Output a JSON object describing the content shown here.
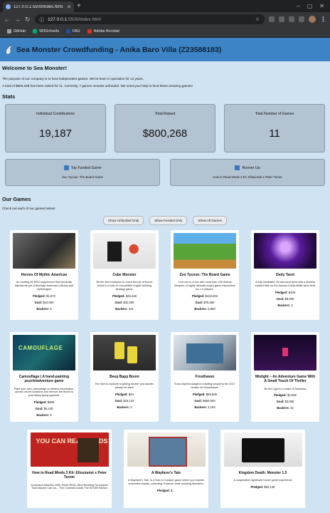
{
  "browser": {
    "tab_title": "127.0.0.1:5500/index.html",
    "url_host": "127.0.0.1",
    "url_path": ":5500/index.html",
    "bookmarks": [
      "GitHub",
      "W3Schools",
      "FAU",
      "Adobe Acrobat"
    ]
  },
  "header": {
    "title": "Sea Monster Crowdfunding - Anika Baro Villa (Z23588183)"
  },
  "intro": {
    "welcome": "Welcome to Sea Monster!",
    "line1": "The purpose of our company is to fund independent games. We've been in operation for 12 years.",
    "line2": "A total of $800,268 has been raised for 11. Currently, 7 games remains unfunded. We need your help to fund these amazing games!"
  },
  "stats": {
    "heading": "Stats",
    "contributions_label": "Individual Contributions",
    "contributions_value": "19,187",
    "raised_label": "Total Raised",
    "raised_value": "$800,268",
    "games_label": "Total Number of Games",
    "games_value": "11",
    "top_label": "Top Funded Game",
    "top_name": "Zoo Tycoon: The Board Game",
    "runner_label": "Runner Up",
    "runner_name": "How to Read Minds 2 Kit: Ellusionist x Peter Turner"
  },
  "games_section": {
    "heading": "Our Games",
    "subtitle": "Check out each of our games below!",
    "btn_unfunded": "Show Unfunded Only",
    "btn_funded": "Show Funded Only",
    "btn_all": "Show All Games"
  },
  "games": [
    {
      "name": "Heroes Of Mythic Americas",
      "desc": "An exciting 5e RPG supplement that heroically represents pre-Columbian American cultures and mythologies",
      "pledged": "Pledged: $1,572",
      "goal": "Goal: $10,000",
      "backers": "Backers: 9"
    },
    {
      "name": "Cube Monster",
      "desc": "Be the first champion to reach the top of Mount Kubia in a solo or competitive engine building strategy game.",
      "pledged": "Pledged: $29,446",
      "goal": "Goal: $32,000",
      "backers": "Backers: 321"
    },
    {
      "name": "Zoo Tycoon: The Board Game",
      "desc": "Your zoo in a box with more than 230 Animal Meeples. A highly thematic board game experience for 1-4 players.",
      "pledged": "Pledged: $442,602",
      "goal": "Goal: $78,480",
      "backers": "Backers: 3,869"
    },
    {
      "name": "Deity Tarot",
      "desc": "A fully illustrated 78-card tarot deck with a divinely exalted take on the famous Smith-Waite tarot deck",
      "pledged": "Pledged: $109",
      "goal": "Goal: $8,000",
      "backers": "Backers: 3"
    },
    {
      "name": "Camouflage | A hand-painting puzzle/adventure game",
      "desc": "Paint your own camouflage to retrieve information, access secret locations and remove the threat to your fellow flying squirrels.",
      "pledged": "Pledged: $698",
      "goal": "Goal: $5,140",
      "backers": "Backers: 9"
    },
    {
      "name": "Beep Bapp Boom",
      "desc": "The time to explode is getting shorter and shorter, please be alert!",
      "pledged": "Pledged: $44",
      "goal": "Goal: $18,133",
      "backers": "Backers: 2"
    },
    {
      "name": "Frosthaven",
      "desc": "Euro-inspired dungeon crawling sequel to the 2017 smash hit Gloomhaven",
      "pledged": "Pledged: $69,608",
      "goal": "Goal: $500,000",
      "backers": "Backers: 3,193"
    },
    {
      "name": "Mislight – An Adventure Game With A Small Touch Of Thriller",
      "desc": "Be the Light in a realm of Darkness",
      "pledged": "Pledged: $1,036",
      "goal": "Goal: $3,099",
      "backers": "Backers: 32"
    },
    {
      "name": "How to Read Minds 2 Kit: Ellusionist x Peter Turner",
      "desc": "Command Attention With These REAL Mind Reading Techniques That Anyone Can Do... The Contents Inside The Kit Will Silence",
      "pledged": "",
      "goal": "",
      "backers": ""
    },
    {
      "name": "A Wayfarer's Tale",
      "desc": "A Wayfarer's Tale, is a Solo to 4 player game where you explore uncharted islands, collecting Treasure while avoiding Monsters.",
      "pledged": "Pledged: $...",
      "goal": "",
      "backers": ""
    },
    {
      "name": "Kingdom Death: Monster 1.5",
      "desc": "A cooperative nightmare horror game experience",
      "pledged": "Pledged: $94,139",
      "goal": "",
      "backers": ""
    }
  ],
  "image_text": {
    "camo": "CAMOUFLAGE",
    "readminds": "YOU CAN READ MINDS"
  }
}
